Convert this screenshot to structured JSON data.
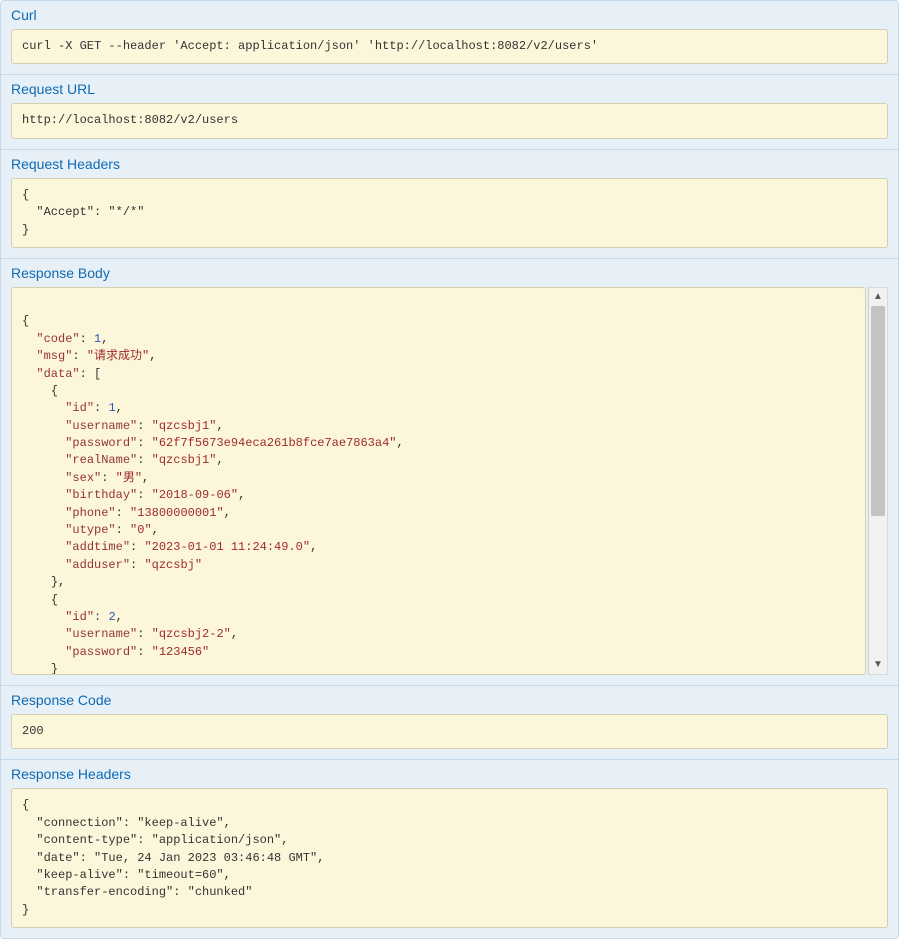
{
  "sections": {
    "curl": {
      "title": "Curl"
    },
    "requestUrl": {
      "title": "Request URL"
    },
    "requestHeaders": {
      "title": "Request Headers"
    },
    "responseBody": {
      "title": "Response Body"
    },
    "responseCode": {
      "title": "Response Code"
    },
    "responseHeaders": {
      "title": "Response Headers"
    }
  },
  "curl": "curl -X GET --header 'Accept: application/json' 'http://localhost:8082/v2/users'",
  "requestUrl": "http://localhost:8082/v2/users",
  "requestHeaders": {
    "Accept": "*/*"
  },
  "responseCode": "200",
  "responseHeaders": {
    "connection": "keep-alive",
    "content-type": "application/json",
    "date": "Tue, 24 Jan 2023 03:46:48 GMT",
    "keep-alive": "timeout=60",
    "transfer-encoding": "chunked"
  },
  "responseBody": {
    "code": 1,
    "msg": "请求成功",
    "data": [
      {
        "id": 1,
        "username": "qzcsbj1",
        "password": "62f7f5673e94eca261b8fce7ae7863a4",
        "realName": "qzcsbj1",
        "sex": "男",
        "birthday": "2018-09-06",
        "phone": "13800000001",
        "utype": "0",
        "addtime": "2023-01-01 11:24:49.0",
        "adduser": "qzcsbj"
      },
      {
        "id": 2,
        "username": "qzcsbj2-2",
        "password": "123456"
      }
    ]
  }
}
